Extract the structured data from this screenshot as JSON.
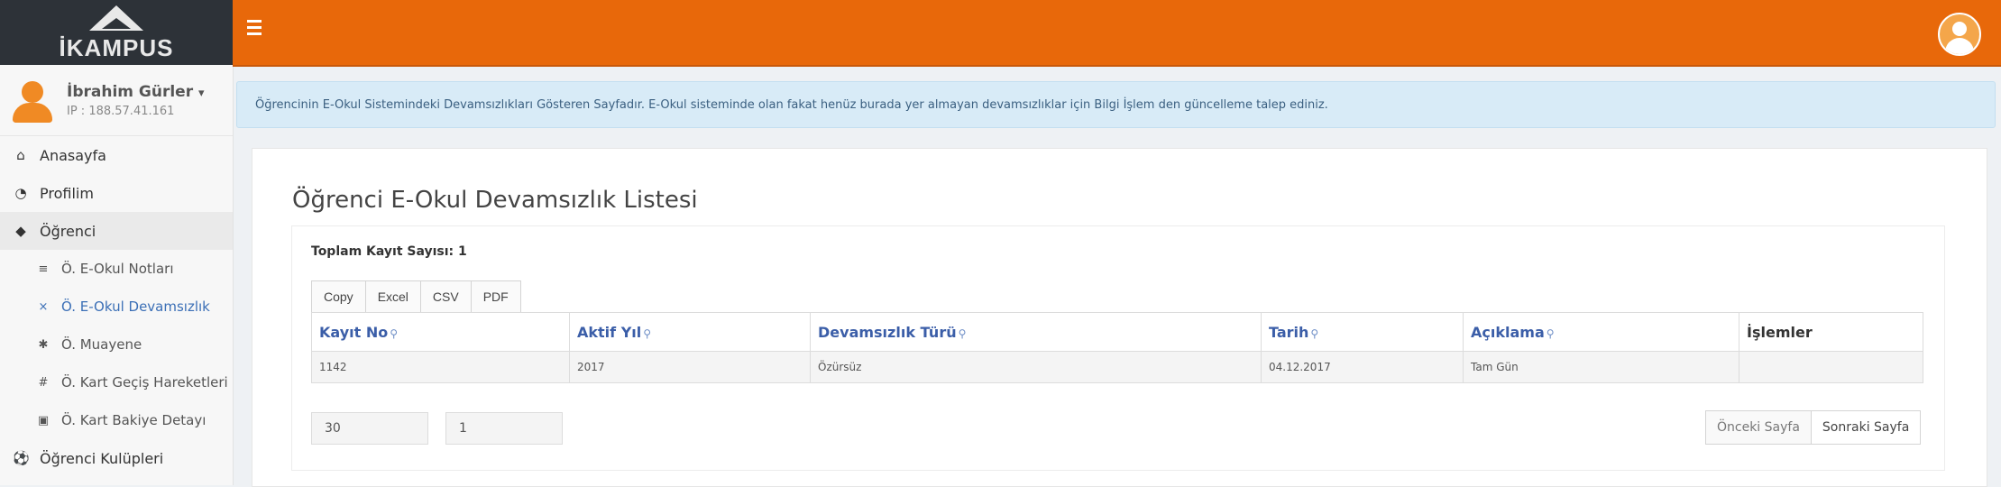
{
  "brand": {
    "logo_text": "İKAMPUS"
  },
  "user": {
    "name": "İbrahim Gürler",
    "caret": "▾",
    "ip": "IP : 188.57.41.161"
  },
  "sidebar": {
    "items": [
      {
        "label": "Anasayfa",
        "icon": "home-icon"
      },
      {
        "label": "Profilim",
        "icon": "user-circle-icon"
      },
      {
        "label": "Öğrenci",
        "icon": "graduation-cap-icon"
      }
    ],
    "sub_items": [
      {
        "label": "Ö. E-Okul Notları",
        "icon": "list-icon"
      },
      {
        "label": "Ö. E-Okul Devamsızlık",
        "icon": "close-icon"
      },
      {
        "label": "Ö. Muayene",
        "icon": "medical-icon"
      },
      {
        "label": "Ö. Kart Geçiş Hareketleri",
        "icon": "hashtag-icon"
      },
      {
        "label": "Ö. Kart Bakiye Detayı",
        "icon": "card-icon"
      }
    ],
    "clubs": {
      "label": "Öğrenci Kulüpleri",
      "icon": "soccer-ball-icon"
    }
  },
  "info_message": "Öğrencinin E-Okul Sistemindeki Devamsızlıkları Gösteren Sayfadır. E-Okul sisteminde olan fakat henüz burada yer almayan devamsızlıklar için Bilgi İşlem den güncelleme talep ediniz.",
  "page_title": "Öğrenci E-Okul Devamsızlık Listesi",
  "total": {
    "label": "Toplam Kayıt Sayısı:",
    "value": "1"
  },
  "export_buttons": [
    "Copy",
    "Excel",
    "CSV",
    "PDF"
  ],
  "table": {
    "columns": [
      "Kayıt No",
      "Aktif Yıl",
      "Devamsızlık Türü",
      "Tarih",
      "Açıklama",
      "İşlemler"
    ],
    "rows": [
      [
        "1142",
        "2017",
        "Özürsüz",
        "04.12.2017",
        "Tam Gün",
        ""
      ]
    ]
  },
  "pagination": {
    "page_size": "30",
    "page_number": "1",
    "prev_label": "Önceki Sayfa",
    "next_label": "Sonraki Sayfa"
  },
  "colors": {
    "topbar": "#e8680a",
    "link": "#3b5ea8",
    "info_bg": "#d8ebf7"
  }
}
